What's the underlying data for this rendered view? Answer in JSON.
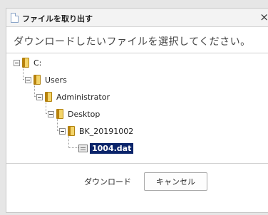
{
  "dialog": {
    "title": "ファイルを取り出す",
    "close_glyph": "×",
    "instruction": "ダウンロードしたいファイルを選択してください。"
  },
  "tree": {
    "drive": "C:",
    "users": "Users",
    "administrator": "Administrator",
    "desktop": "Desktop",
    "backup": "BK_20191002",
    "file": "1004.dat"
  },
  "buttons": {
    "download": "ダウンロード",
    "cancel": "キャンセル"
  },
  "icons": {
    "folder": "folder-icon",
    "file": "file-icon",
    "collapse": "collapse-toggle-icon"
  },
  "colors": {
    "selection": "#0a246a",
    "folder": "#f3d46a"
  }
}
